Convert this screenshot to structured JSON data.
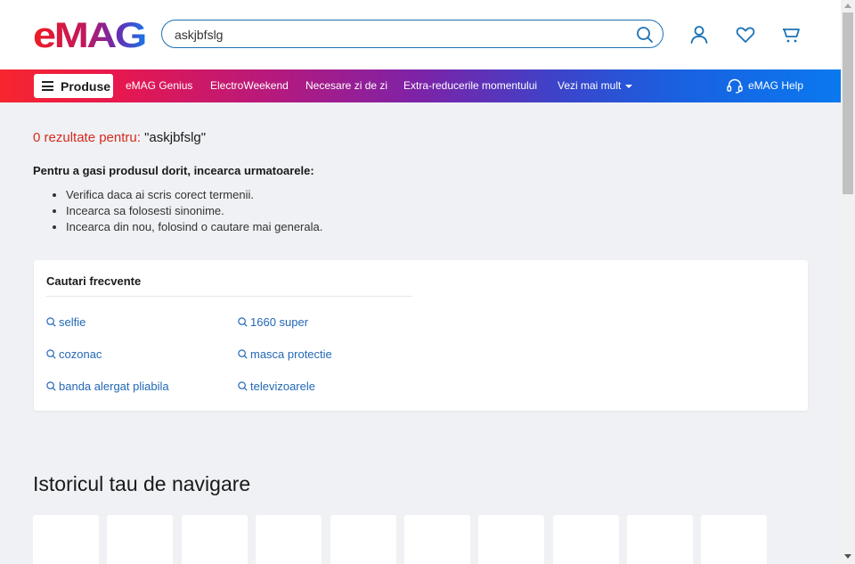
{
  "header": {
    "logo_text": "eMAG",
    "search": {
      "value": "askjbfslg",
      "placeholder": ""
    },
    "icons": [
      "search-icon",
      "user-icon",
      "heart-icon",
      "cart-icon"
    ]
  },
  "nav": {
    "produse_label": "Produse",
    "links": [
      "eMAG Genius",
      "ElectroWeekend",
      "Necesare zi de zi",
      "Extra-reducerile momentului",
      "Vezi mai mult"
    ],
    "help_label": "eMAG Help"
  },
  "results": {
    "prefix": "0 rezultate pentru:",
    "query": "\"askjbfslg\""
  },
  "tips": {
    "title": "Pentru a gasi produsul dorit, incearca urmatoarele:",
    "items": [
      "Verifica daca ai scris corect termenii.",
      "Incearca sa folosesti sinonime.",
      "Incearca din nou, folosind o cautare mai generala."
    ]
  },
  "frequent": {
    "title": "Cautari frecvente",
    "items": [
      "selfie",
      "1660 super",
      "cozonac",
      "masca protectie",
      "banda alergat pliabila",
      "televizoarele"
    ]
  },
  "history": {
    "title": "Istoricul tau de navigare"
  },
  "colors": {
    "accent_red": "#d52b1e",
    "link_blue": "#2368b5",
    "search_border": "#1b72b5",
    "background": "#eff1f4"
  }
}
